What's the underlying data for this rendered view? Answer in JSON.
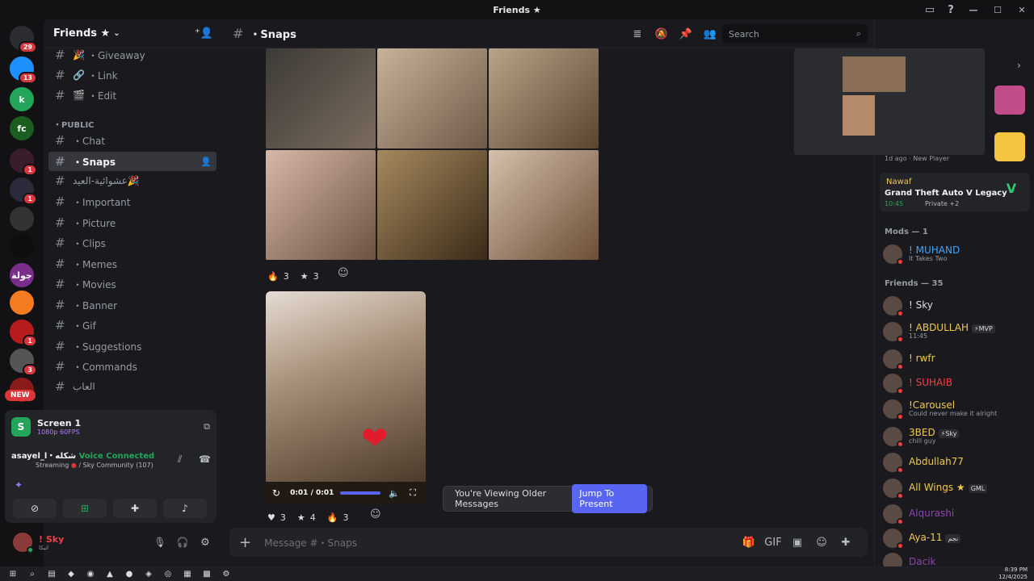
{
  "window": {
    "title": "Friends ★"
  },
  "servers": [
    {
      "abbr": "",
      "badge": "29",
      "color": "#2b2d31"
    },
    {
      "abbr": "",
      "badge": "13",
      "color": "#1e90ff"
    },
    {
      "abbr": "k",
      "badge": "",
      "color": "#23a55a"
    },
    {
      "abbr": "fc",
      "badge": "",
      "color": "#1b5e20"
    },
    {
      "abbr": "",
      "badge": "1",
      "color": "#3a1d2d"
    },
    {
      "abbr": "",
      "badge": "1",
      "color": "#2a2a3a"
    },
    {
      "abbr": "",
      "badge": "",
      "color": "#333"
    },
    {
      "abbr": "",
      "badge": "",
      "color": "#0e0e10"
    },
    {
      "abbr": "جولة",
      "badge": "",
      "color": "#7b2d8b"
    },
    {
      "abbr": "",
      "badge": "",
      "color": "#f47b20"
    },
    {
      "abbr": "",
      "badge": "1",
      "color": "#b71c1c"
    },
    {
      "abbr": "",
      "badge": "3",
      "color": "#555"
    },
    {
      "abbr": "",
      "badge": "",
      "color": "#8b1a1a"
    }
  ],
  "new_badge": "NEW",
  "sidebar": {
    "server_name": "Friends ★",
    "channels_top": [
      {
        "icon": "🎉",
        "label": "・Giveaway"
      },
      {
        "icon": "🔗",
        "label": "・Link"
      },
      {
        "icon": "🎬",
        "label": "・Edit"
      }
    ],
    "category": "・PUBLIC",
    "channels": [
      {
        "label": "・Chat",
        "active": false
      },
      {
        "label": "・Snaps",
        "active": true
      },
      {
        "label": "عشوائية-العيد🎉",
        "active": false
      },
      {
        "label": "・Important",
        "active": false
      },
      {
        "label": "・Picture",
        "active": false
      },
      {
        "label": "・Clips",
        "active": false
      },
      {
        "label": "・Memes",
        "active": false
      },
      {
        "label": "・Movies",
        "active": false
      },
      {
        "label": "・Banner",
        "active": false
      },
      {
        "label": "・Gif",
        "active": false
      },
      {
        "label": "・Suggestions",
        "active": false
      },
      {
        "label": "・Commands",
        "active": false
      },
      {
        "label": "العاب",
        "active": false
      }
    ]
  },
  "voice": {
    "screen_title": "Screen 1",
    "screen_quality": "1080p 60FPS",
    "status_name": "asayel_l・شكله",
    "status": "Voice Connected",
    "streaming": "Streaming",
    "community": "/ Sky Community (107)"
  },
  "user": {
    "name": "! Sky",
    "sub": "انبكا"
  },
  "channel": {
    "name": "・Snaps"
  },
  "header": {
    "search_placeholder": "Search"
  },
  "reactions1": [
    {
      "emoji": "🔥",
      "count": "3"
    },
    {
      "emoji": "★",
      "count": "3"
    }
  ],
  "video": {
    "time": "0:01 / 0:01"
  },
  "reactions2": [
    {
      "emoji": "♥",
      "count": "3"
    },
    {
      "emoji": "★",
      "count": "4"
    },
    {
      "emoji": "🔥",
      "count": "3"
    }
  ],
  "older": {
    "text": "You're Viewing Older Messages",
    "button": "Jump To Present"
  },
  "composer": {
    "placeholder": "Message #・Snaps"
  },
  "members": {
    "activity_time": "1d ago",
    "activity_label": "New Player",
    "game_user": "Nawaf",
    "game_title": "Grand Theft Auto V Legacy",
    "game_time": "10:45",
    "game_private": "Private +2",
    "mods_header": "Mods — 1",
    "mods": [
      {
        "name": "! MUHAND",
        "sub": "It Takes Two",
        "color": "#3ea6ff"
      }
    ],
    "friends_header": "Friends — 35",
    "friends": [
      {
        "name": "! Sky",
        "sub": "",
        "tag": "",
        "color": "#dbdee1"
      },
      {
        "name": "! ABDULLAH",
        "sub": "11:45",
        "tag": "⚡MVP",
        "color": "#f0c94c"
      },
      {
        "name": "! rwfr",
        "sub": "",
        "tag": "",
        "color": "#f0c94c"
      },
      {
        "name": "! SUHAIB",
        "sub": "",
        "tag": "",
        "color": "#ed4245"
      },
      {
        "name": "!Carousel",
        "sub": "Could never make it alright",
        "tag": "",
        "color": "#f0c94c"
      },
      {
        "name": "3BED",
        "sub": "chill guy",
        "tag": "⚡Sky",
        "color": "#f0c94c"
      },
      {
        "name": "Abdullah77",
        "sub": "",
        "tag": "",
        "color": "#f0c94c"
      },
      {
        "name": "All Wings ★",
        "sub": "",
        "tag": "GML",
        "color": "#f0c94c"
      },
      {
        "name": "Alqurashi",
        "sub": "",
        "tag": "",
        "color": "#8e44ad"
      },
      {
        "name": "Aya-11",
        "sub": "",
        "tag": "نجم",
        "color": "#f0c94c"
      },
      {
        "name": "Dacik",
        "sub": "",
        "tag": "",
        "color": "#8e44ad"
      }
    ]
  },
  "taskbar": {
    "time": "8:39 PM",
    "date": "12/4/2025"
  }
}
